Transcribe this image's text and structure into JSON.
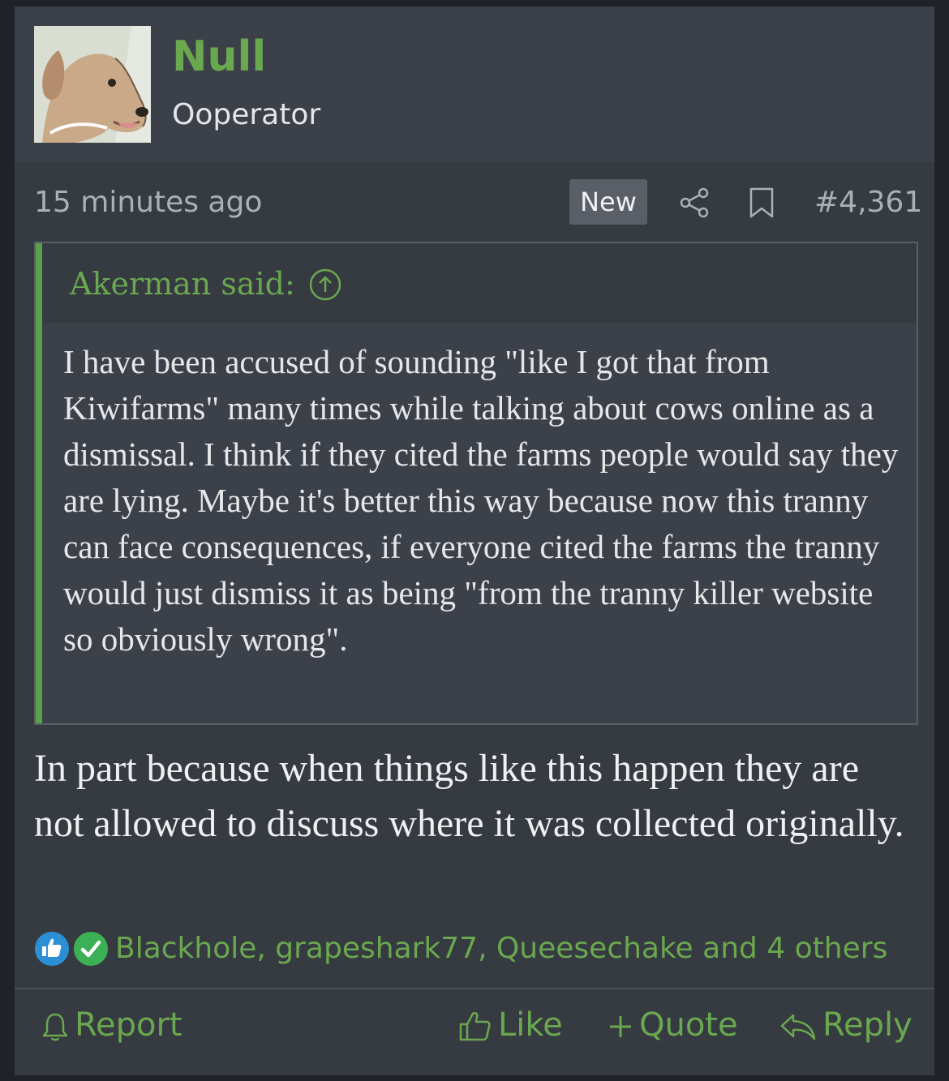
{
  "user": {
    "name": "Null",
    "title": "Ooperator"
  },
  "meta": {
    "time": "15 minutes ago",
    "new_badge": "New",
    "post_number": "#4,361"
  },
  "quote": {
    "attribution": "Akerman said:",
    "text": "I have been accused of sounding \"like I got that from Kiwifarms\" many times while talking about cows online as a dismissal. I think if they cited the farms people would say they are lying. Maybe it's better this way because now this tranny can face consequences, if everyone cited the farms the tranny would just dismiss it as being \"from the tranny killer website so obviously wrong\"."
  },
  "body": "In part because when things like this happen they are not allowed to discuss where it was collected originally.",
  "reactions": {
    "names": "Blackhole, grapeshark77, Queesechake and 4 others",
    "icons": [
      "thumbs-up-icon",
      "checkmark-icon"
    ]
  },
  "actions": {
    "report": "Report",
    "like": "Like",
    "quote": "Quote",
    "reply": "Reply"
  },
  "colors": {
    "accent": "#6aa84f",
    "background": "#363a41",
    "quote_bar": "#5aa14a",
    "like_reaction": "#2b8fd6",
    "agree_reaction": "#3bb054"
  }
}
